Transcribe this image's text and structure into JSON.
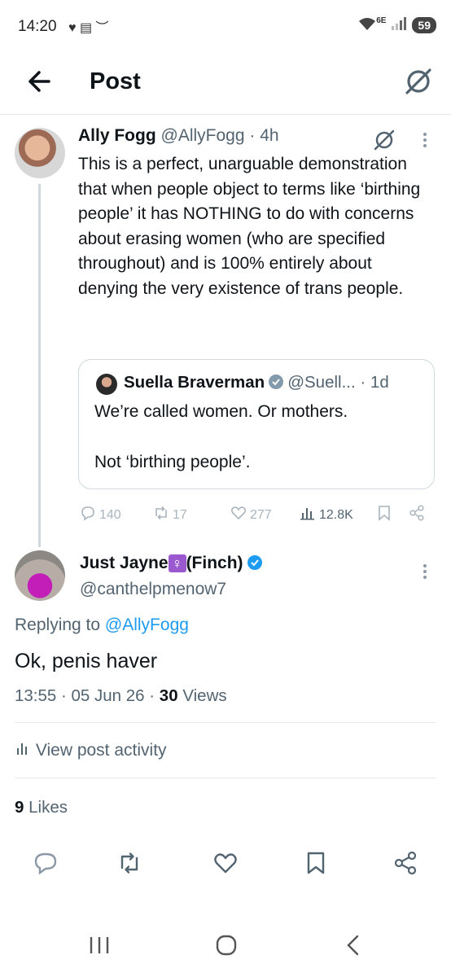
{
  "status_bar": {
    "time": "14:20",
    "left_icons": "♥ ▤ ︶",
    "network": "6E",
    "battery": "59"
  },
  "header": {
    "title": "Post"
  },
  "tweet": {
    "name": "Ally Fogg",
    "handle": "@AllyFogg",
    "time": "· 4h",
    "text": "This is a perfect, unarguable demonstration that when people object to terms like ‘birthing people’ it has NOTHING to do with concerns about erasing women (who are specified throughout) and is 100% entirely about denying the  very existence of trans people.",
    "quote": {
      "name": "Suella Braverman",
      "handle": "@Suell...",
      "time": "· 1d",
      "line1": "We’re called women. Or mothers.",
      "line2": "Not ‘birthing people’."
    },
    "stats": {
      "replies": "140",
      "reposts": "17",
      "likes": "277",
      "views": "12.8K"
    }
  },
  "reply": {
    "name": "Just Jayne",
    "emoji": "♀",
    "name_suffix": "(Finch)",
    "handle": "@canthelpmenow7",
    "replying_prefix": "Replying to",
    "replying_to": "@AllyFogg",
    "text": "Ok,  penis haver",
    "meta_time": "13:55 · 05 Jun 26 ·",
    "views_count": "30",
    "views_label": "Views",
    "activity": "View post activity",
    "likes_count": "9",
    "likes_label": "Likes"
  },
  "colors": {
    "accent": "#1d9bf0",
    "muted": "#536471",
    "text": "#0f1419"
  },
  "icons": [
    "back-arrow-icon",
    "grok-icon",
    "more-icon",
    "reply-icon",
    "repost-icon",
    "like-icon",
    "views-icon",
    "bookmark-icon",
    "share-icon",
    "verified-icon",
    "nav-recents-icon",
    "nav-home-icon",
    "nav-back-icon"
  ]
}
